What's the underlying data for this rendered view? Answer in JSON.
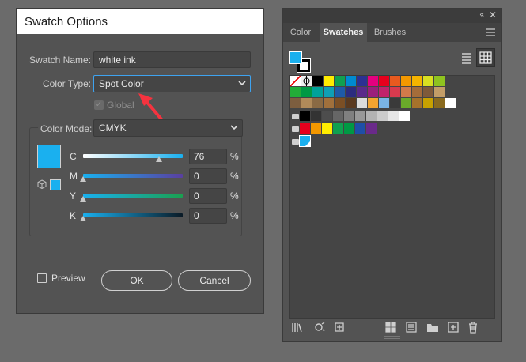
{
  "dialog": {
    "title": "Swatch Options",
    "swatch_name_label": "Swatch Name:",
    "swatch_name_value": "white ink",
    "color_type_label": "Color Type:",
    "color_type_value": "Spot Color",
    "global_label": "Global",
    "color_mode_label": "Color Mode:",
    "color_mode_value": "CMYK",
    "preview_color": "#1ab0ef",
    "channels": [
      {
        "label": "C",
        "value": "76",
        "fraction": 0.76,
        "pct": "%"
      },
      {
        "label": "M",
        "value": "0",
        "fraction": 0,
        "pct": "%"
      },
      {
        "label": "Y",
        "value": "0",
        "fraction": 0,
        "pct": "%"
      },
      {
        "label": "K",
        "value": "0",
        "fraction": 0,
        "pct": "%"
      }
    ],
    "preview_label": "Preview",
    "ok_label": "OK",
    "cancel_label": "Cancel"
  },
  "panel": {
    "tabs": [
      "Color",
      "Swatches",
      "Brushes"
    ],
    "active_tab": "Swatches",
    "fill_color": "#1ab0ef",
    "rows": [
      [
        "#fffffe",
        "#eeeeee",
        "#000000",
        "#ffec00",
        "#10a050",
        "#008ad0",
        "#2b3192",
        "#e4007f",
        "#e6001d",
        "#e85a1f",
        "#f39800",
        "#f5b400",
        "#d9e021",
        "#8fc31f"
      ],
      [
        "#22ac38",
        "#009944",
        "#00a29a",
        "#0f9fb5",
        "#1e5aa8",
        "#2c2c7f",
        "#5a2a8a",
        "#9b1e7b",
        "#c1226b",
        "#d83a4e",
        "#d17a4a",
        "#a56c3a",
        "#7f5a3a",
        "#c39d67"
      ],
      [
        "#7d5e3f",
        "#b08a5a",
        "#8a6a44",
        "#a0703c",
        "#7b4f25",
        "#5a3a20",
        "#dcdcdc",
        "#f3a531",
        "#7ab5e6",
        "#3a3a3a",
        "#6aaa2a",
        "#a5722b",
        "#c8a100",
        "#8a6a1e",
        "#ffffff"
      ],
      [
        "#000000",
        "#333333",
        "#4d4d4d",
        "#666666",
        "#808080",
        "#999999",
        "#b3b3b3",
        "#cccccc",
        "#e6e6e6",
        "#ffffff"
      ],
      [
        "#e6001d",
        "#f39800",
        "#ffec00",
        "#10a050",
        "#009944",
        "#1e4fa8",
        "#6a2a8a"
      ],
      [
        "#1ab0ef"
      ]
    ]
  }
}
